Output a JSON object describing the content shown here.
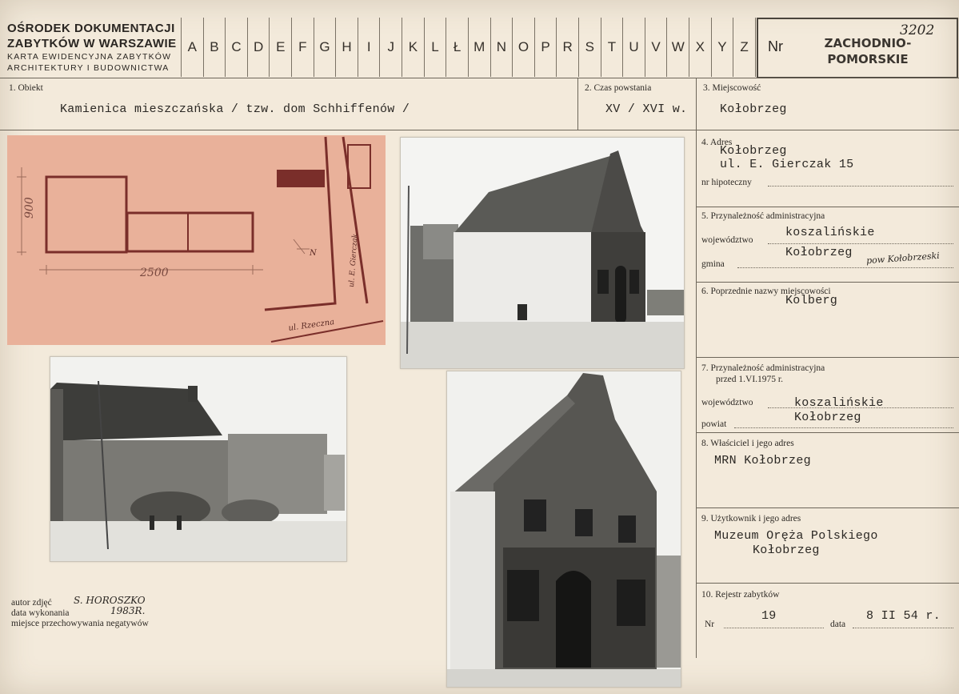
{
  "header": {
    "org_line1": "OŚRODEK DOKUMENTACJI",
    "org_line2": "ZABYTKÓW W WARSZAWIE",
    "org_line3": "KARTA EWIDENCYJNA ZABYTKÓW",
    "org_line4": "ARCHITEKTURY I BUDOWNICTWA",
    "alphabet": [
      "A",
      "B",
      "C",
      "D",
      "E",
      "F",
      "G",
      "H",
      "I",
      "J",
      "K",
      "L",
      "Ł",
      "M",
      "N",
      "O",
      "P",
      "R",
      "S",
      "T",
      "U",
      "V",
      "W",
      "X",
      "Y",
      "Z"
    ],
    "nr_label": "Nr",
    "region_line1": "ZACHODNIO-",
    "region_line2": "POMORSKIE",
    "inventory_number": "3202"
  },
  "fields": {
    "obiekt_label": "1. Obiekt",
    "obiekt_value": "Kamienica mieszczańska / tzw. dom Schhiffenów /",
    "czas_label": "2. Czas powstania",
    "czas_value": "XV / XVI w.",
    "miejscowosc_label": "3. Miejscowość",
    "miejscowosc_value": "Kołobrzeg",
    "adres_label": "4. Adres",
    "adres_line1": "Kołobrzeg",
    "adres_line2": "ul. E. Gierczak 15",
    "hipoteczny_label": "nr hipoteczny",
    "przynaleznosc_label": "5. Przynależność administracyjna",
    "wojewodztwo_label": "województwo",
    "wojewodztwo_value": "koszalińskie",
    "gmina_label": "gmina",
    "gmina_value": "Kołobrzeg",
    "gmina_note": "pow Kołobrzeski",
    "poprzednie_label": "6. Poprzednie nazwy miejscowości",
    "poprzednie_value": "Kolberg",
    "przed_label1": "7. Przynależność administracyjna",
    "przed_label2": "przed 1.VI.1975 r.",
    "przed_woj_label": "województwo",
    "przed_woj_value": "koszalińskie",
    "powiat_label": "powiat",
    "powiat_value": "Kołobrzeg",
    "wlasciciel_label": "8. Właściciel i jego adres",
    "wlasciciel_value": "MRN Kołobrzeg",
    "uzytkownik_label": "9. Użytkownik i jego adres",
    "uzytkownik_line1": "Muzeum Oręża Polskiego",
    "uzytkownik_line2": "Kołobrzeg",
    "rejestr_label": "10. Rejestr zabytków",
    "rejestr_nr_label": "Nr",
    "rejestr_nr_value": "19",
    "rejestr_data_label": "data",
    "rejestr_data_value": "8 II 54 r."
  },
  "footer": {
    "autor_label": "autor zdjęć",
    "autor_value": "S. HOROSZKO",
    "data_label": "data wykonania",
    "data_value": "1983R.",
    "miejsce_label": "miejsce przechowywania negatywów"
  },
  "plan": {
    "dim_vertical": "900",
    "dim_horizontal": "2500",
    "street1": "ul. E. Gierczak",
    "street2": "ul. Rzeczna",
    "north": "N"
  },
  "colors": {
    "card": "#f3eadb",
    "plan_paper": "#e9b19a",
    "plan_ink": "#7a2e2a"
  }
}
